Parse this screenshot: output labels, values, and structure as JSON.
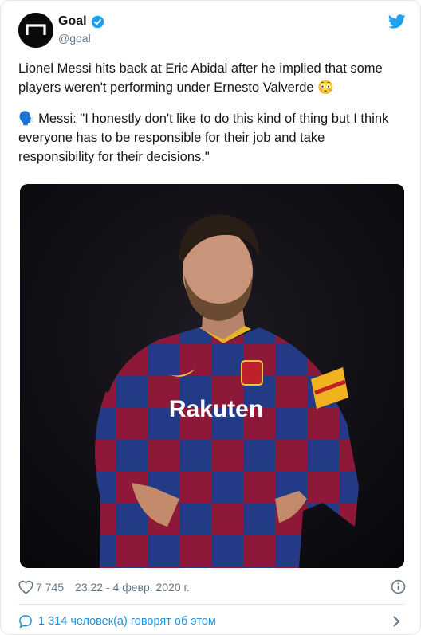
{
  "account": {
    "display_name": "Goal",
    "handle": "@goal",
    "verified": true
  },
  "tweet": {
    "paragraph1": "Lionel Messi hits back at Eric Abidal after he implied that some players weren't performing under Ernesto Valverde 😳",
    "paragraph2": "🗣️ Messi: \"I honestly don't like to do this kind of thing but I think everyone has to be responsible for their job and take responsibility for their decisions.\""
  },
  "photo": {
    "kind": "photo",
    "jersey_sponsor": "Rakuten"
  },
  "meta": {
    "likes": "7 745",
    "timestamp": "23:22 - 4 февр. 2020 г."
  },
  "conversation": {
    "label": "1 314 человек(а) говорят об этом"
  },
  "colors": {
    "accent": "#1b95e0",
    "verified": "#1da1f2",
    "text": "#14171a",
    "muted": "#657786",
    "border": "#e1e8ed"
  },
  "icons": {
    "avatar": "goal-logo",
    "verified": "verified-badge-icon",
    "brand": "twitter-bird-icon",
    "like": "heart-icon",
    "info": "info-icon",
    "comment": "speech-bubble-icon",
    "more": "chevron-right-icon"
  }
}
